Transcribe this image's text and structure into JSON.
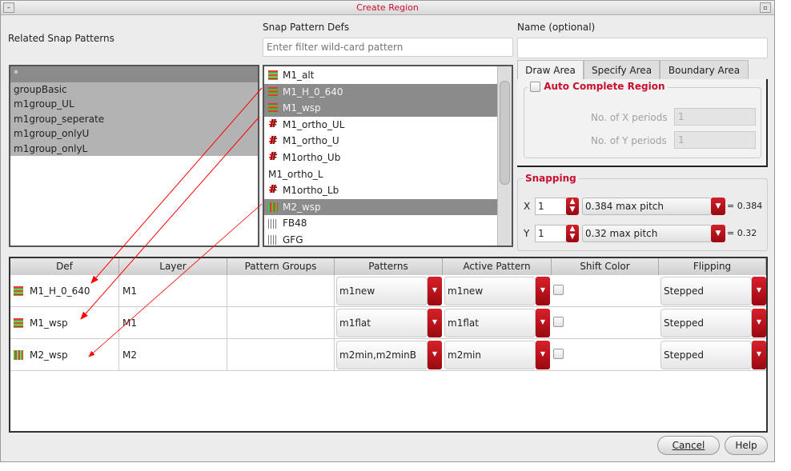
{
  "window": {
    "title": "Create Region"
  },
  "related": {
    "label": "Related Snap Patterns",
    "items": [
      "*",
      "groupBasic",
      "m1group_UL",
      "m1group_seperate",
      "m1group_onlyU",
      "m1group_onlyL"
    ]
  },
  "defs": {
    "label": "Snap Pattern Defs",
    "filter_placeholder": "Enter filter wild-card pattern",
    "items": [
      {
        "name": "M1_alt",
        "icon": "hstripe",
        "selected": false
      },
      {
        "name": "M1_H_0_640",
        "icon": "hstripe",
        "selected": true
      },
      {
        "name": "M1_wsp",
        "icon": "hstripe",
        "selected": true
      },
      {
        "name": "M1_ortho_UL",
        "icon": "hash",
        "selected": false
      },
      {
        "name": "M1_ortho_U",
        "icon": "hash",
        "selected": false
      },
      {
        "name": "M1ortho_Ub",
        "icon": "hash",
        "selected": false
      },
      {
        "name": "M1_ortho_L",
        "icon": "none",
        "selected": false
      },
      {
        "name": "M1ortho_Lb",
        "icon": "hash",
        "selected": false
      },
      {
        "name": "M2_wsp",
        "icon": "vstripe",
        "selected": true
      },
      {
        "name": "FB48",
        "icon": "gray",
        "selected": false
      },
      {
        "name": "GFG",
        "icon": "gray",
        "selected": false
      }
    ]
  },
  "name_field": {
    "label": "Name (optional)",
    "value": ""
  },
  "tabs": [
    "Draw Area",
    "Specify Area",
    "Boundary Area"
  ],
  "auto_complete": {
    "label": "Auto Complete Region",
    "checked": false,
    "x_label": "No. of X periods",
    "x_value": "1",
    "y_label": "No. of Y periods",
    "y_value": "1"
  },
  "snapping": {
    "label": "Snapping",
    "x_label": "X",
    "x_value": "1",
    "x_pitch": "0.384 max pitch",
    "x_result": "= 0.384",
    "y_label": "Y",
    "y_value": "1",
    "y_pitch": "0.32 max pitch",
    "y_result": "= 0.32"
  },
  "table": {
    "headers": [
      "Def",
      "Layer",
      "Pattern Groups",
      "Patterns",
      "Active Pattern",
      "Shift Color",
      "Flipping"
    ],
    "rows": [
      {
        "def": "M1_H_0_640",
        "icon": "hstripe",
        "layer": "M1",
        "groups": "",
        "patterns": "m1new",
        "active": "m1new",
        "shift": false,
        "flipping": "Stepped"
      },
      {
        "def": "M1_wsp",
        "icon": "hstripe",
        "layer": "M1",
        "groups": "",
        "patterns": "m1flat",
        "active": "m1flat",
        "shift": false,
        "flipping": "Stepped"
      },
      {
        "def": "M2_wsp",
        "icon": "vstripe",
        "layer": "M2",
        "groups": "",
        "patterns": "m2min,m2minB",
        "active": "m2min",
        "shift": false,
        "flipping": "Stepped"
      }
    ]
  },
  "buttons": {
    "cancel": "Cancel",
    "help": "Help"
  },
  "colors": {
    "accent": "#c8102e",
    "selection": "#8b8b8b",
    "annotation": "#ff0000"
  }
}
